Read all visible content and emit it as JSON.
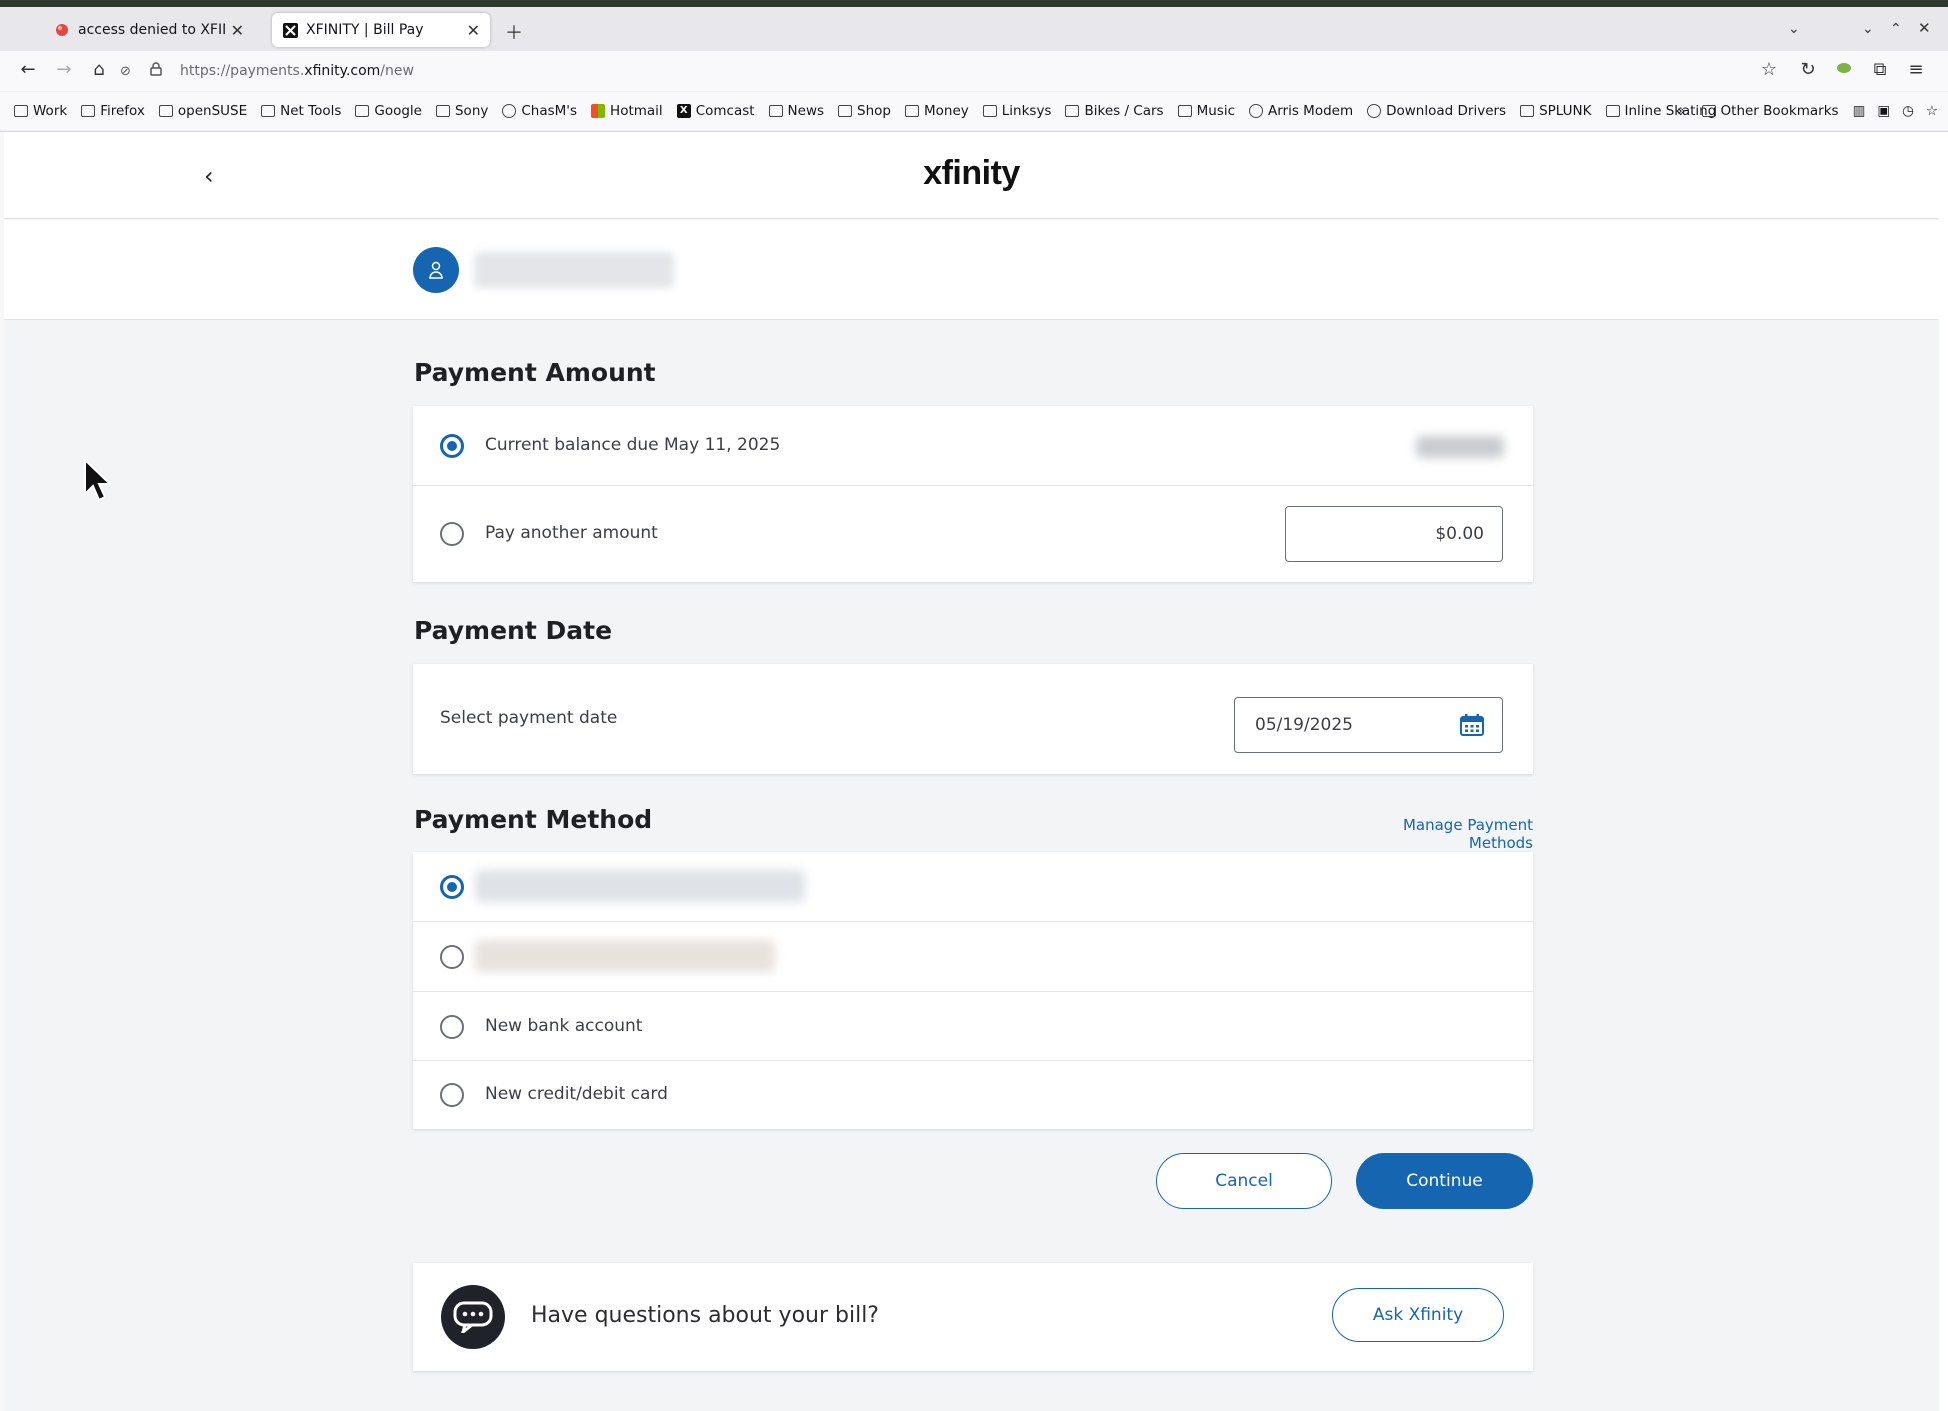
{
  "browser": {
    "tabs": [
      {
        "title": "access denied to XFINITY.com",
        "active": false
      },
      {
        "title": "XFINITY | Bill Pay",
        "active": true
      }
    ],
    "url_prefix": "https://payments.",
    "url_host": "xfinity.com",
    "url_path": "/new",
    "bookmarks": [
      "Work",
      "Firefox",
      "openSUSE",
      "Net Tools",
      "Google",
      "Sony",
      "ChasM's",
      "Hotmail",
      "Comcast",
      "News",
      "Shop",
      "Money",
      "Linksys",
      "Bikes / Cars",
      "Music",
      "Arris Modem",
      "Download Drivers",
      "SPLUNK",
      "Inline Skating"
    ],
    "other_bookmarks": "Other Bookmarks"
  },
  "header": {
    "logo": "xfinity"
  },
  "payment_amount": {
    "title": "Payment Amount",
    "current_balance_label": "Current balance due May 11, 2025",
    "other_amount_label": "Pay another amount",
    "other_amount_value": "$0.00"
  },
  "payment_date": {
    "title": "Payment Date",
    "label": "Select payment date",
    "value": "05/19/2025"
  },
  "payment_method": {
    "title": "Payment Method",
    "manage_link": "Manage Payment Methods",
    "new_bank": "New bank account",
    "new_card": "New credit/debit card"
  },
  "actions": {
    "cancel": "Cancel",
    "continue": "Continue"
  },
  "help": {
    "question": "Have questions about your bill?",
    "button": "Ask Xfinity"
  },
  "colors": {
    "brand_blue": "#1565b0",
    "page_bg": "#f2f4f5"
  }
}
